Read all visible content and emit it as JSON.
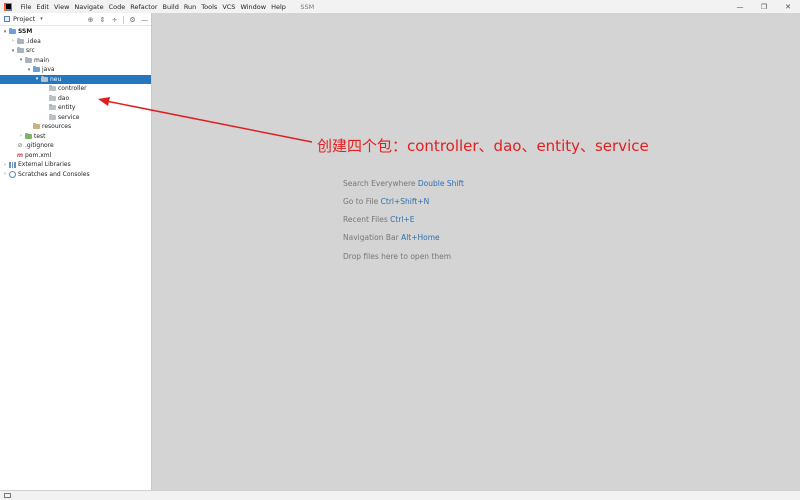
{
  "menu": [
    "File",
    "Edit",
    "View",
    "Navigate",
    "Code",
    "Refactor",
    "Build",
    "Run",
    "Tools",
    "VCS",
    "Window",
    "Help"
  ],
  "window_title": "SSM",
  "window_controls": {
    "minimize": "—",
    "restore": "❐",
    "close": "✕"
  },
  "project_panel": {
    "title": "Project",
    "caret": "▾",
    "tools": {
      "locate": "⊕",
      "collapse": "⇕",
      "expand": "÷",
      "settings": "⚙",
      "hide": "—"
    }
  },
  "tree": [
    {
      "label": "SSM",
      "icon": "folder",
      "arrow": "▾"
    },
    {
      "label": ".idea",
      "icon": "folder",
      "arrow": "›"
    },
    {
      "label": "src",
      "icon": "folder",
      "arrow": "▾"
    },
    {
      "label": "main",
      "icon": "folder",
      "arrow": "▾"
    },
    {
      "label": "java",
      "icon": "folder-blue",
      "arrow": "▾"
    },
    {
      "label": "neu",
      "icon": "package",
      "arrow": "▾"
    },
    {
      "label": "controller",
      "icon": "package",
      "arrow": ""
    },
    {
      "label": "dao",
      "icon": "package",
      "arrow": ""
    },
    {
      "label": "entity",
      "icon": "package",
      "arrow": ""
    },
    {
      "label": "service",
      "icon": "package",
      "arrow": ""
    },
    {
      "label": "resources",
      "icon": "folder-resources",
      "arrow": ""
    },
    {
      "label": "test",
      "icon": "folder-green",
      "arrow": "›"
    },
    {
      "label": ".gitignore",
      "icon": "gitignore-file",
      "arrow": ""
    },
    {
      "label": "pom.xml",
      "icon": "maven-file",
      "arrow": ""
    },
    {
      "label": "External Libraries",
      "icon": "libraries",
      "arrow": "›"
    },
    {
      "label": "Scratches and Consoles",
      "icon": "scratches",
      "arrow": "›"
    }
  ],
  "icon_glyphs": {
    "gitignore": "⊘",
    "maven": "m"
  },
  "annotation": "创建四个包：controller、dao、entity、service",
  "hints": [
    {
      "text": "Search Everywhere",
      "key": "Double Shift"
    },
    {
      "text": "Go to File",
      "key": "Ctrl+Shift+N"
    },
    {
      "text": "Recent Files",
      "key": "Ctrl+E"
    },
    {
      "text": "Navigation Bar",
      "key": "Alt+Home"
    },
    {
      "text": "Drop files here to open them",
      "key": ""
    }
  ],
  "colors": {
    "selection": "#2675bf",
    "annotation": "#e02020",
    "hint_key": "#2f6fb0"
  }
}
